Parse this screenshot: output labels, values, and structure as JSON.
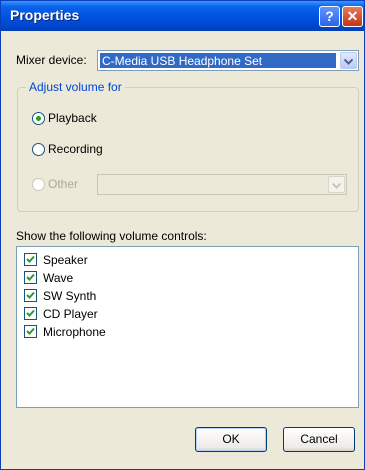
{
  "window": {
    "title": "Properties",
    "help_glyph": "?",
    "close_glyph": "✕"
  },
  "mixer": {
    "label": "Mixer device:",
    "value": "C-Media USB Headphone Set"
  },
  "adjust": {
    "group_label": "Adjust volume for",
    "options": [
      {
        "label": "Playback",
        "selected": true,
        "enabled": true
      },
      {
        "label": "Recording",
        "selected": false,
        "enabled": true
      },
      {
        "label": "Other",
        "selected": false,
        "enabled": false
      }
    ],
    "other_value": ""
  },
  "controls": {
    "label": "Show the following volume controls:",
    "items": [
      {
        "label": "Speaker",
        "checked": true
      },
      {
        "label": "Wave",
        "checked": true
      },
      {
        "label": "SW Synth",
        "checked": true
      },
      {
        "label": "CD Player",
        "checked": true
      },
      {
        "label": "Microphone",
        "checked": true
      }
    ]
  },
  "buttons": {
    "ok": "OK",
    "cancel": "Cancel"
  },
  "colors": {
    "title_bar": "#0054e3",
    "group_label": "#0046d5",
    "selection": "#316ac5",
    "check": "#21a121",
    "dialog_bg": "#ece9d8"
  }
}
